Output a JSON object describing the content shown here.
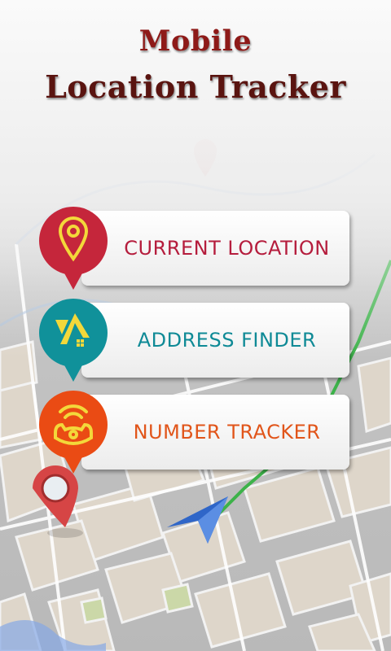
{
  "app": {
    "title_line1": "Mobile",
    "title_line2": "Location Tracker"
  },
  "menu": [
    {
      "label": "CURRENT LOCATION",
      "color": "#b51d3d",
      "pin_color": "#c5263b",
      "icon": "map-pin-icon"
    },
    {
      "label": "ADDRESS FINDER",
      "color": "#0f8a96",
      "pin_color": "#10919a",
      "icon": "home-arrow-icon"
    },
    {
      "label": "NUMBER TRACKER",
      "color": "#e1551a",
      "pin_color": "#ea4b14",
      "icon": "phone-signal-icon"
    }
  ]
}
